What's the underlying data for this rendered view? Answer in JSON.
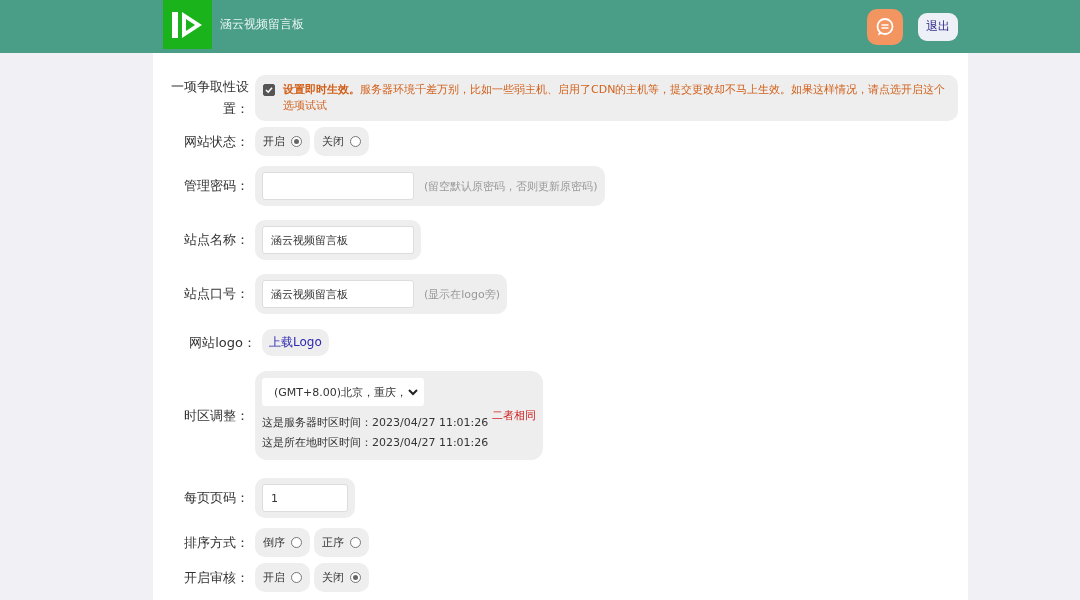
{
  "header": {
    "site_title": "涵云视频留言板",
    "logout": "退出"
  },
  "rows": [
    {
      "kind": "checkbox",
      "label": "一项争取性设置：",
      "checked": true,
      "text": "**设置即时生效。**服务器环境千差万别，比如一些弱主机、启用了CDN的主机等，提交更改却不马上生效。如果这样情况，请点选开启这个选项试试"
    },
    {
      "kind": "radio",
      "label": "网站状态：",
      "options": [
        {
          "label": "开启",
          "selected": true
        },
        {
          "label": "关闭",
          "selected": false
        }
      ]
    },
    {
      "kind": "input",
      "label": "管理密码：",
      "value": "",
      "hint": "(留空默认原密码，否则更新原密码)"
    },
    {
      "kind": "input",
      "label": "站点名称：",
      "value": "涵云视频留言板"
    },
    {
      "kind": "input",
      "label": "站点口号：",
      "value": "涵云视频留言板",
      "hint": "(显示在logo旁)"
    },
    {
      "kind": "upload",
      "label": "网站logo：",
      "link": "上载Logo"
    },
    {
      "kind": "timezone",
      "label": "时区调整：",
      "select": "(GMT+8.00)北京，重庆，",
      "server_time": "这是服务器时区时间：2023/04/27 11:01:26",
      "local_time": "这是所在地时区时间：2023/04/27 11:01:26",
      "note": "二者相同"
    },
    {
      "kind": "number",
      "label": "每页页码：",
      "value": "1"
    },
    {
      "kind": "radio",
      "label": "排序方式：",
      "options": [
        {
          "label": "倒序",
          "selected": false
        },
        {
          "label": "正序",
          "selected": false
        }
      ]
    },
    {
      "kind": "radio",
      "label": "开启审核：",
      "options": [
        {
          "label": "开启",
          "selected": false
        },
        {
          "label": "关闭",
          "selected": true
        }
      ]
    }
  ]
}
